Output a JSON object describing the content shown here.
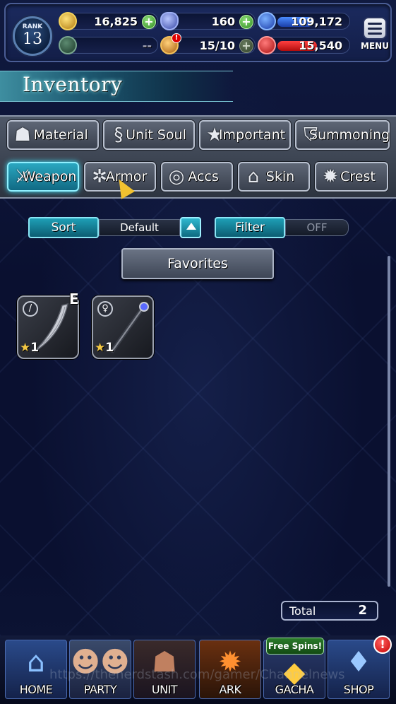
{
  "header": {
    "rank_label": "RANK",
    "rank_value": "13",
    "gil": "16,825",
    "crystals": "160",
    "blue_points": "109,172",
    "guild_value": "--",
    "stamina": "15/10",
    "red_points": "15,540",
    "menu_label": "MENU"
  },
  "page": {
    "title": "Inventory"
  },
  "tabs": {
    "row1": [
      {
        "label": "Material"
      },
      {
        "label": "Unit Soul"
      },
      {
        "label": "Important"
      },
      {
        "label": "Summoning"
      }
    ],
    "row2": [
      {
        "label": "Weapon"
      },
      {
        "label": "Armor"
      },
      {
        "label": "Accs"
      },
      {
        "label": "Skin"
      },
      {
        "label": "Crest"
      }
    ]
  },
  "controls": {
    "sort_label": "Sort",
    "sort_value": "Default",
    "filter_label": "Filter",
    "filter_value": "OFF",
    "favorites_label": "Favorites"
  },
  "items": [
    {
      "rarity": "1",
      "equipped_mark": "E"
    },
    {
      "rarity": "1"
    }
  ],
  "total": {
    "label": "Total",
    "value": "2"
  },
  "nav": {
    "free_spins": "Free Spins!",
    "notification": "!",
    "items": [
      {
        "label": "HOME"
      },
      {
        "label": "PARTY"
      },
      {
        "label": "UNIT"
      },
      {
        "label": "ARK"
      },
      {
        "label": "GACHA"
      },
      {
        "label": "SHOP"
      }
    ]
  },
  "colors": {
    "accent_cyan": "#2aa7c0",
    "header_bg": "#1b2a5e",
    "plus_green": "#2f8a20"
  },
  "watermark": "https://thenerdstash.com/gamer/Channelnews"
}
